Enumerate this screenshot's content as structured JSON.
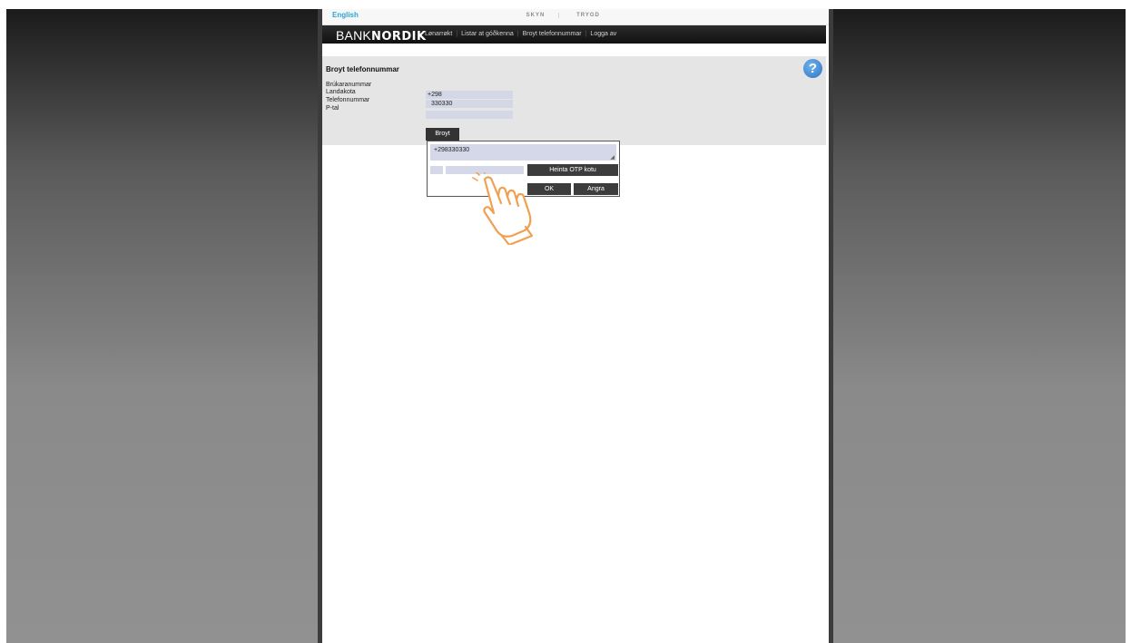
{
  "header": {
    "language_link": "English",
    "skyn": "SKYN",
    "trygd": "TRYGD"
  },
  "navbar": {
    "logo_light": "BANK",
    "logo_bold": "NORDIK",
    "links": [
      "Lønarrøkt",
      "Listar at góðkenna",
      "Broyt telefonnummar",
      "Logga av"
    ]
  },
  "form": {
    "title": "Broyt telefonnummar",
    "help_symbol": "?",
    "fields": [
      {
        "label": "Brúkaranummar",
        "value": ""
      },
      {
        "label": "Landakota",
        "value": "+298"
      },
      {
        "label": "Telefonnummar",
        "value": "330330"
      },
      {
        "label": "P-tal",
        "value": ""
      }
    ],
    "change_button": "Broyt"
  },
  "dialog": {
    "phone_display": "+298330330",
    "otp_button": "Heinta OTP kotu",
    "ok_button": "OK",
    "cancel_button": "Angra"
  },
  "colors": {
    "accent_link": "#2aa6d8",
    "navbar": "#1a1a1a",
    "field_bg": "#d3d7e6",
    "hand_pointer": "#f0a050"
  },
  "icons": {
    "help": "help-question-icon",
    "pointer": "hand-pointer-icon"
  }
}
